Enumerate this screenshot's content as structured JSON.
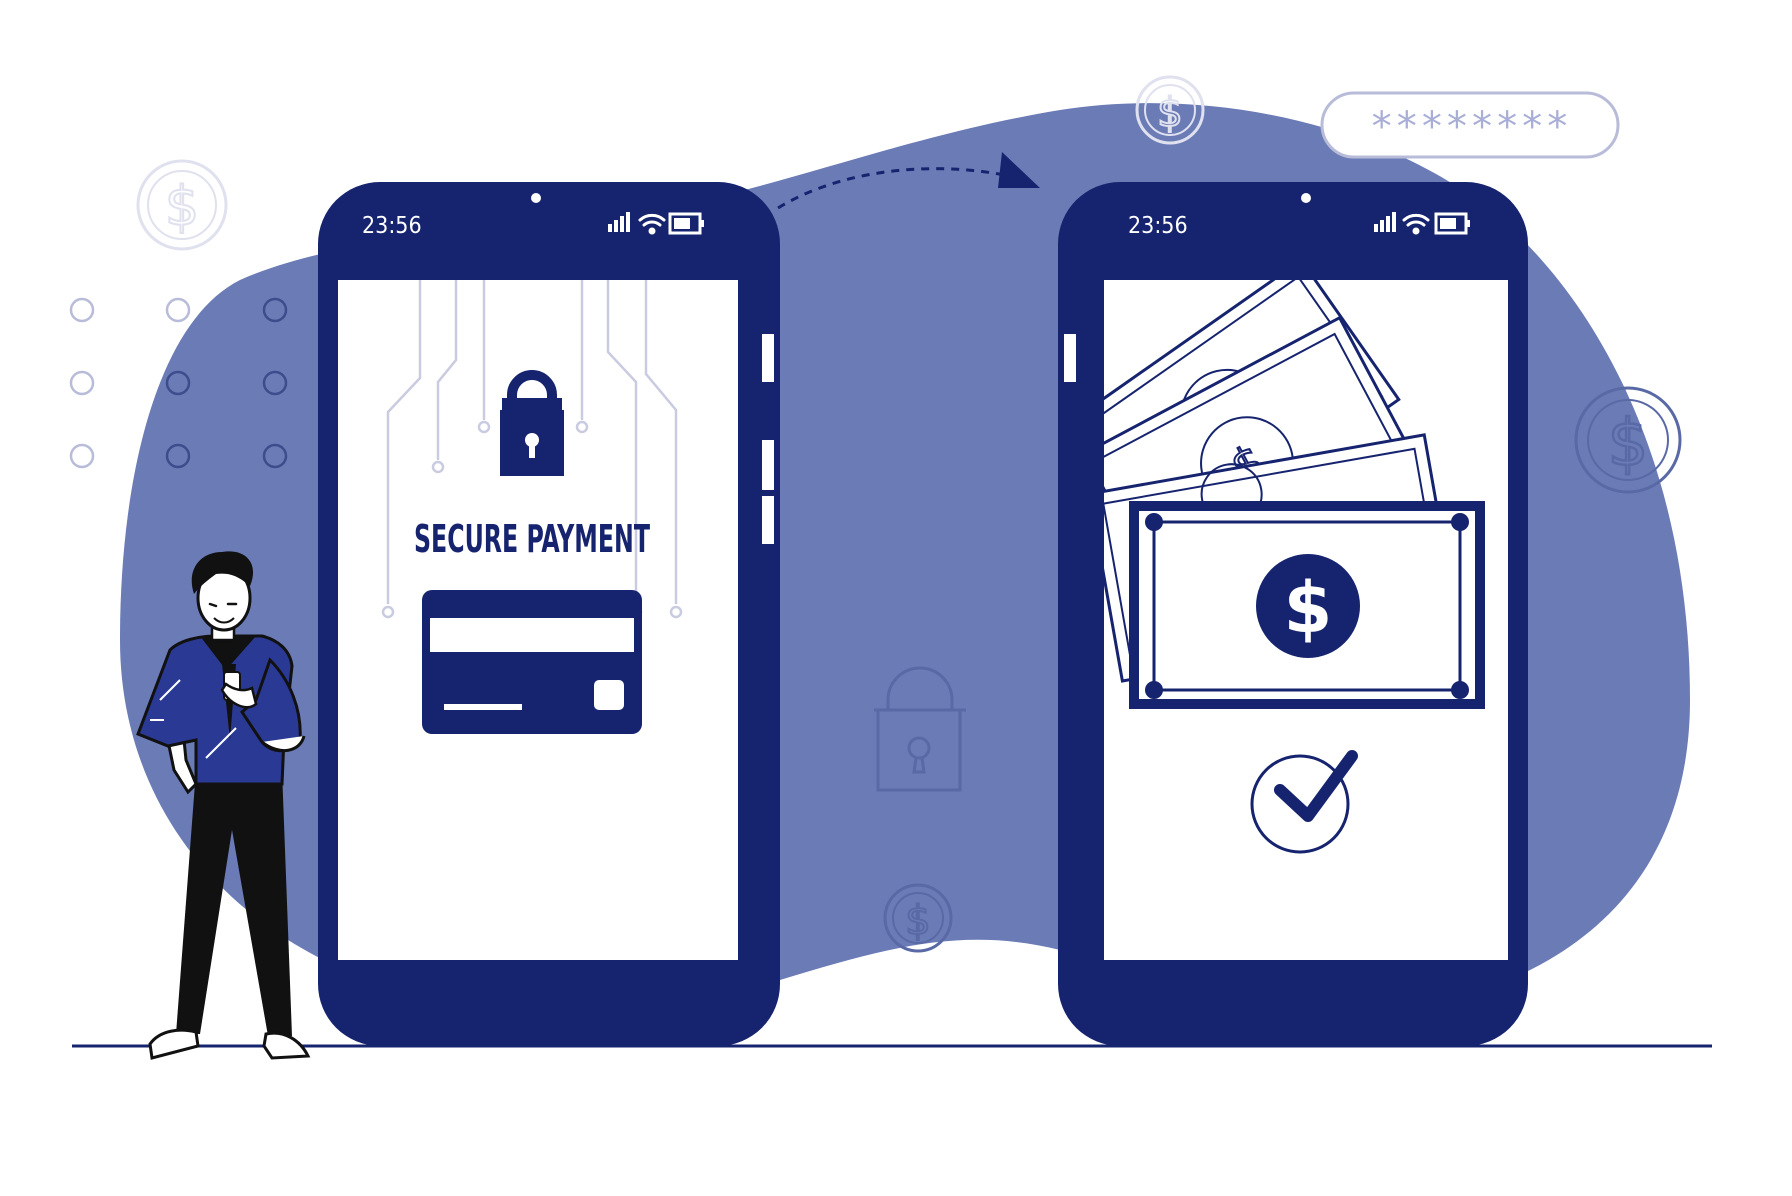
{
  "colors": {
    "navy": "#16246f",
    "blob": "#6b7bb6",
    "screen": "#ffffff",
    "faint": "#d8dae8",
    "faint_blob": "#5969a6"
  },
  "phone_left": {
    "time": "23:56",
    "title": "SECURE PAYMENT",
    "icons": [
      "signal-icon",
      "wifi-icon",
      "battery-icon",
      "padlock-icon",
      "credit-card-icon"
    ]
  },
  "phone_right": {
    "time": "23:56",
    "icons": [
      "signal-icon",
      "wifi-icon",
      "battery-icon",
      "banknote-stack-icon",
      "dollar-coin-icon",
      "checkmark-icon"
    ]
  },
  "password_field": {
    "value": "********"
  },
  "decorations": [
    "dollar-coin-icon",
    "padlock-icon",
    "dotted-arrow",
    "dot-grid",
    "person-with-phone"
  ]
}
